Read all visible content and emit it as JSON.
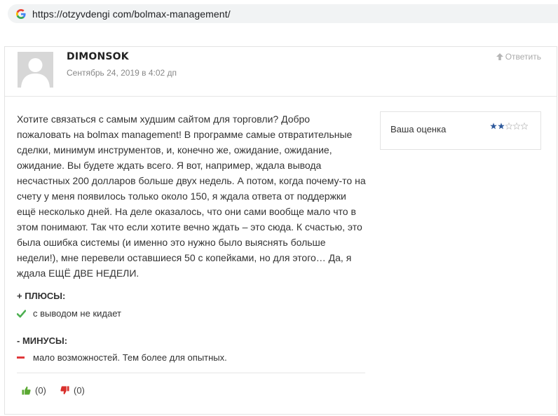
{
  "browser": {
    "url": "https://otzyvdengi com/bolmax-management/"
  },
  "comment": {
    "author": "DIMONSOK",
    "date": "Сентябрь 24, 2019 в 4:02 дп",
    "reply_label": "Ответить",
    "text": "Хотите связаться с самым худшим сайтом для торговли? Добро пожаловать на bolmax management! В программе самые отвратительные сделки, минимум инструментов, и, конечно же, ожидание, ожидание, ожидание. Вы будете ждать всего. Я вот, например, ждала вывода несчастных 200 долларов больше двух недель. А потом, когда почему-то на счету у меня появилось только около 150, я ждала ответа от поддержки ещё несколько дней. На деле оказалось, что они сами вообще мало что в этом понимают. Так что если хотите вечно ждать – это сюда. К счастью, это была ошибка системы (и именно это нужно было выяснять больше недели!), мне перевели оставшиеся 50 с копейками, но для этого… Да, я ждала ЕЩЁ ДВЕ НЕДЕЛИ.",
    "rating_label": "Ваша оценка",
    "rating_value": 2,
    "rating_max": 5,
    "pros_title": "+ ПЛЮСЫ:",
    "pros": [
      "с выводом не кидает"
    ],
    "cons_title": "- МИНУСЫ:",
    "cons": [
      "мало возможностей. Тем более для опытных."
    ],
    "likes": "(0)",
    "dislikes": "(0)"
  },
  "colors": {
    "star_filled": "#2f5a9c",
    "star_empty": "#c9c9c9",
    "check": "#4caf50",
    "minus": "#e0383b",
    "thumb_up": "#5aa832",
    "thumb_down": "#d9302c"
  },
  "icons": {
    "browser": "google-g-icon",
    "reply": "arrow-up-icon",
    "pro": "check-icon",
    "con": "minus-icon",
    "like": "thumb-up-icon",
    "dislike": "thumb-down-icon"
  }
}
